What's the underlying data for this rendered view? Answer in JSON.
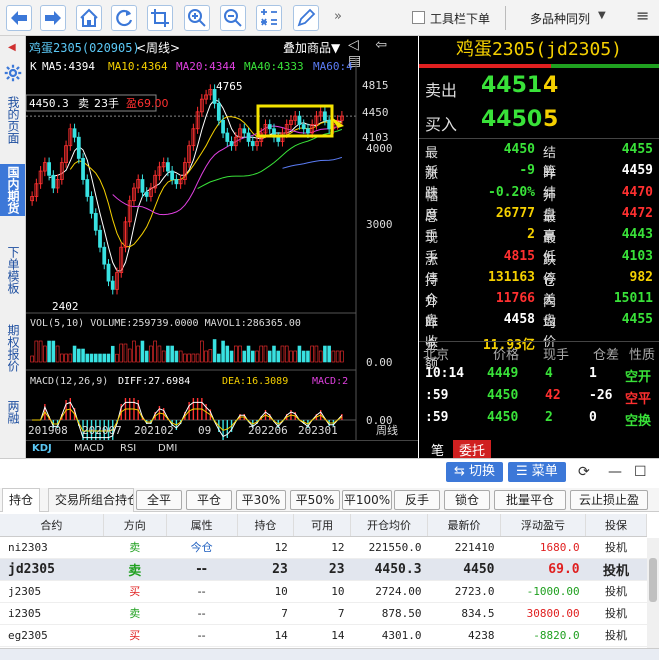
{
  "toolbar": {
    "chevron": "»",
    "toolbar_order_label": "工具栏下单",
    "multi_layout_label": "多品种同列",
    "dropdown_glyph": "▼",
    "menu_glyph": "≡"
  },
  "sidebar": {
    "arrow": "◀",
    "tabs": [
      {
        "label": "我的页面",
        "active": false
      },
      {
        "label": "国内期货",
        "active": true
      },
      {
        "label": "下单模板",
        "active": false
      },
      {
        "label": "期权报价",
        "active": false
      },
      {
        "label": "两融",
        "active": false
      }
    ]
  },
  "chart": {
    "title": "鸡蛋2305(020905)",
    "cycle": "<周线>",
    "overlay_label": "叠加商品▼",
    "nav": "◁ ⇦ ▤",
    "ma_line": {
      "k": "K",
      "ma5": "MA5:4394",
      "ma10": "MA10:4364",
      "ma20": "MA20:4344",
      "ma40": "MA40:4333",
      "ma60": "MA60:4"
    },
    "position_tag": {
      "price": "4450.3",
      "side": "卖",
      "qty": "23手",
      "pnl": "盈69.00"
    },
    "price_axis": [
      "4815",
      "4450",
      "4103",
      "4000",
      "3000"
    ],
    "annotations": {
      "high": "4765",
      "low": "2402"
    },
    "vol_line": "VOL(5,10) VOLUME:259739.0000 MAVOL1:286365.00",
    "vol_axis": "0.00",
    "macd_line": {
      "name": "MACD(12,26,9)",
      "diff": "DIFF:27.6984",
      "dea": "DEA:16.3089",
      "macd": "MACD:2"
    },
    "macd_axis": "0.00",
    "date_axis": [
      "201908",
      "202007",
      "202102",
      "09",
      "202206",
      "202301"
    ],
    "date_axis_suffix": "周线",
    "subtabs": [
      "KDJ",
      "MACD",
      "RSI",
      "DMI"
    ],
    "price_series_weekly": [
      3500,
      3650,
      3800,
      3900,
      3750,
      3600,
      3700,
      3900,
      4100,
      4300,
      4200,
      3950,
      3700,
      3500,
      3300,
      3100,
      2900,
      2700,
      2500,
      2402,
      2600,
      2900,
      3200,
      3450,
      3600,
      3700,
      3550,
      3500,
      3600,
      3750,
      3850,
      3900,
      3800,
      3700,
      3650,
      3700,
      3900,
      4100,
      4300,
      4500,
      4650,
      4700,
      4765,
      4600,
      4400,
      4250,
      4150,
      4100,
      4200,
      4300,
      4250,
      4150,
      4100,
      4150,
      4250,
      4350,
      4300,
      4200,
      4150,
      4250,
      4350,
      4400,
      4450,
      4350,
      4300,
      4250,
      4350,
      4450,
      4500,
      4400,
      4300,
      4350,
      4400,
      4450
    ]
  },
  "quote": {
    "title": "鸡蛋2305(jd2305)",
    "sell_label": "卖出",
    "sell_price": "4451",
    "sell_qty": "4",
    "buy_label": "买入",
    "buy_price": "4450",
    "buy_qty": "5",
    "fields": [
      {
        "label": "最新",
        "value": "4450",
        "color": "#39e239"
      },
      {
        "label": "结算",
        "value": "4455",
        "color": "#39e239"
      },
      {
        "label": "涨跌",
        "value": "-9",
        "color": "#39e239"
      },
      {
        "label": "昨结",
        "value": "4459",
        "color": "#ffffff"
      },
      {
        "label": "幅度",
        "value": "-0.20%",
        "color": "#39e239"
      },
      {
        "label": "开盘",
        "value": "4470",
        "color": "#ff3030"
      },
      {
        "label": "总手",
        "value": "26777",
        "color": "#f5d000"
      },
      {
        "label": "最高",
        "value": "4472",
        "color": "#ff3030"
      },
      {
        "label": "现手",
        "value": "2",
        "color": "#f5d000"
      },
      {
        "label": "最低",
        "value": "4443",
        "color": "#39e239"
      },
      {
        "label": "涨停",
        "value": "4815",
        "color": "#ff3030"
      },
      {
        "label": "跌停",
        "value": "4103",
        "color": "#39e239"
      },
      {
        "label": "持仓",
        "value": "131163",
        "color": "#f5d000"
      },
      {
        "label": "仓差",
        "value": "982",
        "color": "#f5d000"
      },
      {
        "label": "外盘",
        "value": "11766",
        "color": "#ff3030"
      },
      {
        "label": "内盘",
        "value": "15011",
        "color": "#39e239"
      },
      {
        "label": "昨收",
        "value": "4458",
        "color": "#ffffff"
      },
      {
        "label": "均价",
        "value": "4455",
        "color": "#39e239"
      },
      {
        "label": "金额",
        "value": "11.93亿",
        "color": "#f5d000"
      }
    ],
    "trades_header": {
      "region": "北京",
      "price": "价格",
      "qty": "现手",
      "oi": "仓差",
      "nature": "性质"
    },
    "trades": [
      {
        "time": "10:14",
        "price": "4449",
        "qty": "4",
        "oi": "1",
        "nature": "空开",
        "price_color": "#39e239",
        "qty_color": "#39e239",
        "nature_color": "#39e239"
      },
      {
        "time": ":59",
        "price": "4450",
        "qty": "42",
        "oi": "-26",
        "nature": "空平",
        "price_color": "#39e239",
        "qty_color": "#ff3030",
        "nature_color": "#ff3030"
      },
      {
        "time": ":59",
        "price": "4450",
        "qty": "2",
        "oi": "0",
        "nature": "空换",
        "price_color": "#39e239",
        "qty_color": "#39e239",
        "nature_color": "#39e239"
      }
    ],
    "tabs": [
      {
        "label": "笔",
        "active": false
      },
      {
        "label": "委托",
        "active": true
      }
    ]
  },
  "trade": {
    "switch_label": "⇆ 切换",
    "menu_label": "☰ 菜单",
    "icons": [
      "⟳",
      "—",
      "☐"
    ],
    "tabs": [
      {
        "label": "持仓",
        "active": true
      },
      {
        "label": "交易所组合持仓",
        "active": false
      }
    ],
    "actions": [
      "全平",
      "平仓",
      "平30%",
      "平50%",
      "平100%",
      "反手",
      "锁仓",
      "批量平仓",
      "云止损止盈"
    ],
    "columns": [
      "合约",
      "方向",
      "属性",
      "持仓",
      "可用",
      "开仓均价",
      "最新价",
      "浮动盈亏",
      "投保"
    ],
    "rows": [
      {
        "contract": "ni2303",
        "dir": "卖",
        "dir_color": "#20a020",
        "attr": "今仓",
        "attr_color": "#2060c0",
        "hold": "12",
        "avail": "12",
        "open": "221550.0",
        "last": "221410",
        "pnl": "1680.0",
        "pnl_color": "#e02020",
        "hedge": "投机",
        "selected": false
      },
      {
        "contract": "jd2305",
        "dir": "卖",
        "dir_color": "#20a020",
        "attr": "--",
        "attr_color": "#222222",
        "hold": "23",
        "avail": "23",
        "open": "4450.3",
        "last": "4450",
        "pnl": "69.0",
        "pnl_color": "#e02020",
        "hedge": "投机",
        "selected": true
      },
      {
        "contract": "j2305",
        "dir": "买",
        "dir_color": "#e02020",
        "attr": "--",
        "attr_color": "#222222",
        "hold": "10",
        "avail": "10",
        "open": "2724.00",
        "last": "2723.0",
        "pnl": "-1000.00",
        "pnl_color": "#20a020",
        "hedge": "投机",
        "selected": false
      },
      {
        "contract": "i2305",
        "dir": "卖",
        "dir_color": "#20a020",
        "attr": "--",
        "attr_color": "#222222",
        "hold": "7",
        "avail": "7",
        "open": "878.50",
        "last": "834.5",
        "pnl": "30800.00",
        "pnl_color": "#e02020",
        "hedge": "投机",
        "selected": false
      },
      {
        "contract": "eg2305",
        "dir": "买",
        "dir_color": "#e02020",
        "attr": "--",
        "attr_color": "#222222",
        "hold": "14",
        "avail": "14",
        "open": "4301.0",
        "last": "4238",
        "pnl": "-8820.0",
        "pnl_color": "#20a020",
        "hedge": "投机",
        "selected": false
      }
    ]
  }
}
